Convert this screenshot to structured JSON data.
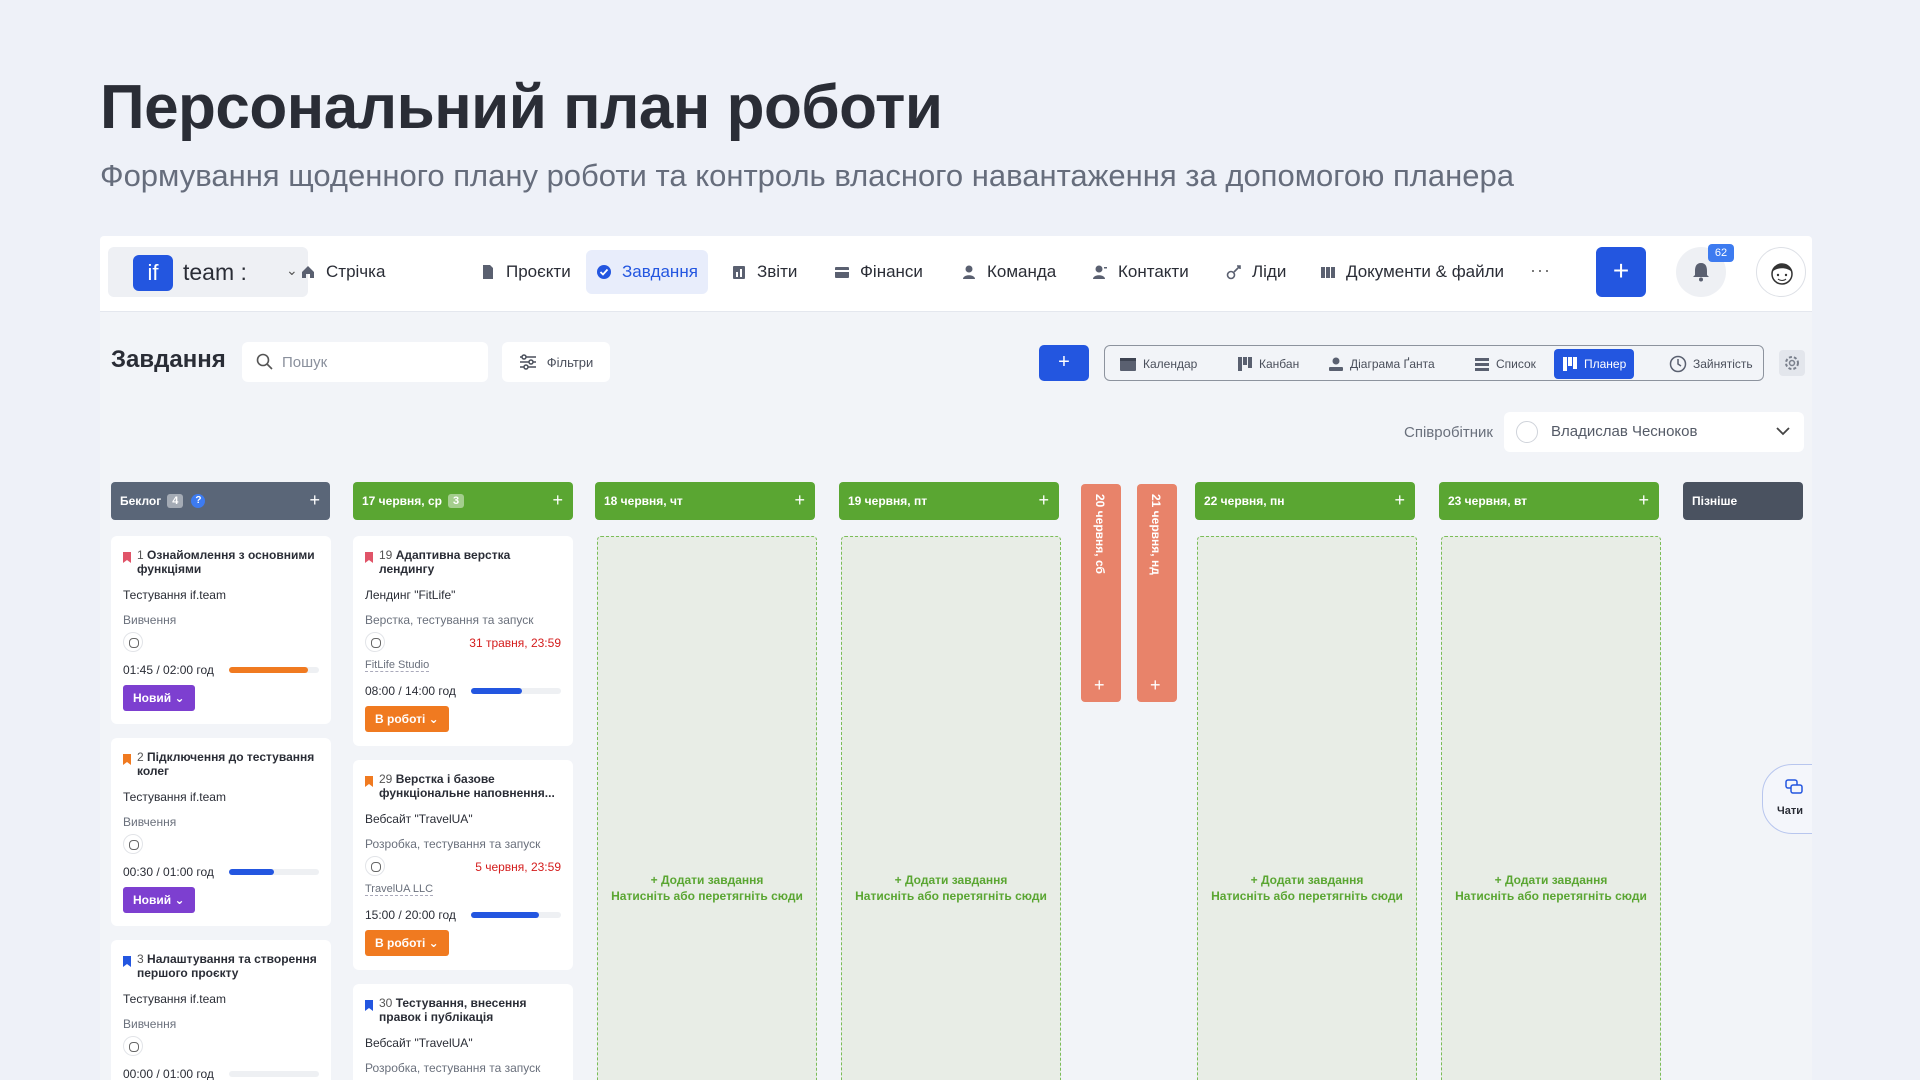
{
  "hero": {
    "title": "Персональний план роботи",
    "subtitle": "Формування щоденного плану роботи та контроль власного навантаження за допомогою планера"
  },
  "brand": {
    "logo": "if",
    "name": "team :"
  },
  "nav": {
    "items": [
      {
        "label": "Стрічка",
        "icon": "home-icon"
      },
      {
        "label": "Проєкти",
        "icon": "file-icon"
      },
      {
        "label": "Завдання",
        "icon": "check-circle-icon",
        "active": true
      },
      {
        "label": "Звіти",
        "icon": "report-icon"
      },
      {
        "label": "Фінанси",
        "icon": "wallet-icon"
      },
      {
        "label": "Команда",
        "icon": "user-icon"
      },
      {
        "label": "Контакти",
        "icon": "contacts-icon"
      },
      {
        "label": "Ліди",
        "icon": "leads-icon"
      },
      {
        "label": "Документи & файли",
        "icon": "docs-icon"
      }
    ],
    "more": "···",
    "plus": "+",
    "notifications": "62"
  },
  "toolbar": {
    "title": "Завдання",
    "search_placeholder": "Пошук",
    "filters": "Фільтри",
    "add": "+",
    "views": [
      "Календар",
      "Канбан",
      "Діаграма Ґанта",
      "Список",
      "Планер",
      "Зайнятість"
    ],
    "active_view": "Планер"
  },
  "employee": {
    "label": "Співробітник",
    "name": "Владислав Чесноков"
  },
  "columns": {
    "backlog": {
      "title": "Беклог",
      "count": "4",
      "help": "?"
    },
    "d17": {
      "title": "17 червня, ср",
      "count": "3"
    },
    "d18": {
      "title": "18 червня, чт"
    },
    "d19": {
      "title": "19 червня, пт"
    },
    "d20": {
      "title": "20 червня, сб"
    },
    "d21": {
      "title": "21 червня, нд"
    },
    "d22": {
      "title": "22 червня, пн"
    },
    "d23": {
      "title": "23 червня, вт"
    },
    "later": {
      "title": "Пізніше"
    },
    "plus": "+"
  },
  "dropzone": {
    "line1": "+ Додати завдання",
    "line2": "Натисніть або перетягніть сюди"
  },
  "backlog_cards": [
    {
      "num": "1",
      "title": "Ознайомлення з основними функціями",
      "project": "Тестування if.team",
      "stage": "Вивчення",
      "time": "01:45 / 02:00 год",
      "progress": 0.875,
      "bar_color": "#f07a20",
      "status": "Новий ⌄",
      "flag": "#e05468"
    },
    {
      "num": "2",
      "title": "Підключення до тестування колег",
      "project": "Тестування if.team",
      "stage": "Вивчення",
      "time": "00:30 / 01:00 год",
      "progress": 0.5,
      "bar_color": "#2356e0",
      "status": "Новий ⌄",
      "flag": "#f07a20"
    },
    {
      "num": "3",
      "title": "Налаштування та створення першого проєкту",
      "project": "Тестування if.team",
      "stage": "Вивчення",
      "time": "00:00 / 01:00 год",
      "progress": 0,
      "bar_color": "#2356e0",
      "flag": "#2356e0"
    }
  ],
  "day17_cards": [
    {
      "num": "19",
      "title": "Адаптивна верстка лендингу",
      "project": "Лендинг \"FitLife\"",
      "stage": "Верстка, тестування та запуск",
      "date": "31 травня, 23:59",
      "client": "FitLife Studio",
      "time": "08:00 / 14:00 год",
      "progress": 0.57,
      "bar_color": "#2356e0",
      "status": "В роботі ⌄",
      "flag": "#e05468"
    },
    {
      "num": "29",
      "title": "Верстка і базове функціональне наповнення...",
      "project": "Вебсайт \"TravelUA\"",
      "stage": "Розробка, тестування та запуск",
      "date": "5 червня, 23:59",
      "client": "TravelUA LLC",
      "time": "15:00 / 20:00 год",
      "progress": 0.75,
      "bar_color": "#2356e0",
      "status": "В роботі ⌄",
      "flag": "#f07a20"
    },
    {
      "num": "30",
      "title": "Тестування, внесення правок і публікація",
      "project": "Вебсайт \"TravelUA\"",
      "stage": "Розробка, тестування та запуск",
      "flag": "#2356e0"
    }
  ],
  "chats": {
    "label": "Чати"
  }
}
